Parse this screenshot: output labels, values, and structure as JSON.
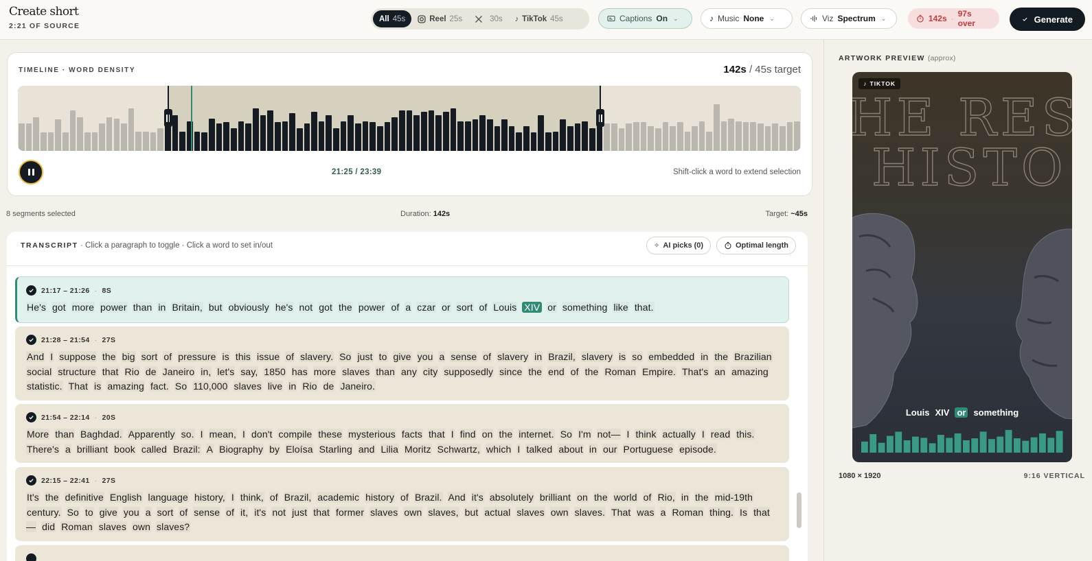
{
  "header": {
    "title": "Create short",
    "subtitle": "2:21 OF SOURCE",
    "platforms": [
      {
        "name": "All",
        "duration": "45s",
        "active": true
      },
      {
        "name": "Reel",
        "duration": "25s",
        "icon": "instagram-icon"
      },
      {
        "name": "",
        "duration": "30s",
        "icon": "x-icon"
      },
      {
        "name": "TikTok",
        "duration": "45s",
        "icon": "tiktok-icon"
      }
    ],
    "captions": {
      "label": "Captions",
      "value": "On"
    },
    "music": {
      "label": "Music",
      "value": "None"
    },
    "viz": {
      "label": "Viz",
      "value": "Spectrum"
    },
    "duration_status": {
      "value": "142s",
      "separator": "·",
      "over": "97s over"
    },
    "generate_label": "Generate"
  },
  "timeline": {
    "label": "TIMELINE · WORD DENSITY",
    "current": "142s",
    "target_text": "/ 45s target",
    "time": "21:25 / 23:39",
    "hint": "Shift-click a word to extend selection",
    "selection_start": 0.192,
    "selection_end": 0.744,
    "playhead": 0.221,
    "densities": [
      0.42,
      0.42,
      0.52,
      0.28,
      0.28,
      0.48,
      0.28,
      0.62,
      0.52,
      0.28,
      0.28,
      0.42,
      0.52,
      0.5,
      0.42,
      0.65,
      0.3,
      0.3,
      0.28,
      0.35,
      0.42,
      0.55,
      0.3,
      0.45,
      0.3,
      0.28,
      0.5,
      0.42,
      0.44,
      0.35,
      0.45,
      0.42,
      0.65,
      0.55,
      0.62,
      0.44,
      0.45,
      0.58,
      0.35,
      0.42,
      0.6,
      0.45,
      0.55,
      0.35,
      0.45,
      0.55,
      0.42,
      0.45,
      0.44,
      0.38,
      0.44,
      0.52,
      0.62,
      0.62,
      0.55,
      0.6,
      0.62,
      0.55,
      0.6,
      0.65,
      0.45,
      0.45,
      0.48,
      0.55,
      0.48,
      0.38,
      0.48,
      0.38,
      0.28,
      0.38,
      0.28,
      0.55,
      0.28,
      0.3,
      0.48,
      0.38,
      0.42,
      0.45,
      0.35,
      0.38,
      0.42,
      0.42,
      0.35,
      0.42,
      0.44,
      0.44,
      0.38,
      0.35,
      0.44,
      0.38,
      0.44,
      0.3,
      0.38,
      0.45,
      0.3,
      0.72,
      0.45,
      0.5,
      0.45,
      0.44,
      0.44,
      0.42,
      0.38,
      0.42,
      0.38,
      0.44,
      0.45
    ]
  },
  "stats": {
    "selected": "8 segments selected",
    "duration_label": "Duration:",
    "duration_value": "142s",
    "target_label": "Target:",
    "target_value": "~45s"
  },
  "transcript": {
    "title": "TRANSCRIPT",
    "subtitle": "· Click a paragraph to toggle · Click a word to set in/out",
    "ai_picks": "AI picks (0)",
    "optimal": "Optimal length",
    "segments": [
      {
        "time": "21:17 – 21:26",
        "duration": "8S",
        "active": true,
        "words": [
          "He's",
          "got",
          "more",
          "power",
          "than",
          "in",
          "Britain,",
          "but",
          "obviously",
          "he's",
          "not",
          "got",
          "the",
          "power",
          "of",
          "a",
          "czar",
          "or",
          "sort",
          "of",
          "Louis",
          "XIV",
          "or",
          "something",
          "like",
          "that."
        ],
        "highlight": 21
      },
      {
        "time": "21:28 – 21:54",
        "duration": "27S",
        "words": [
          "And",
          "I",
          "suppose",
          "the",
          "big",
          "sort",
          "of",
          "pressure",
          "is",
          "this",
          "issue",
          "of",
          "slavery.",
          "So",
          "just",
          "to",
          "give",
          "you",
          "a",
          "sense",
          "of",
          "slavery",
          "in",
          "Brazil,",
          "slavery",
          "is",
          "so",
          "embedded",
          "in",
          "the",
          "Brazilian",
          "social",
          "structure",
          "that",
          "Rio",
          "de",
          "Janeiro",
          "in,",
          "let's",
          "say,",
          "1850",
          "has",
          "more",
          "slaves",
          "than",
          "any",
          "city",
          "supposedly",
          "since",
          "the",
          "end",
          "of",
          "the",
          "Roman",
          "Empire.",
          "That's",
          "an",
          "amazing",
          "statistic.",
          "That",
          "is",
          "amazing",
          "fact.",
          "So",
          "110,000",
          "slaves",
          "live",
          "in",
          "Rio",
          "de",
          "Janeiro."
        ]
      },
      {
        "time": "21:54 – 22:14",
        "duration": "20S",
        "words": [
          "More",
          "than",
          "Baghdad.",
          "Apparently",
          "so.",
          "I",
          "mean,",
          "I",
          "don't",
          "compile",
          "these",
          "mysterious",
          "facts",
          "that",
          "I",
          "find",
          "on",
          "the",
          "internet.",
          "So",
          "I'm",
          "not—",
          "I",
          "think",
          "actually",
          "I",
          "read",
          "this.",
          "There's",
          "a",
          "brilliant",
          "book",
          "called",
          "Brazil:",
          "A",
          "Biography",
          "by",
          "Eloísa",
          "Starling",
          "and",
          "Lilia",
          "Moritz",
          "Schwartz,",
          "which",
          "I",
          "talked",
          "about",
          "in",
          "our",
          "Portuguese",
          "episode."
        ]
      },
      {
        "time": "22:15 – 22:41",
        "duration": "27S",
        "words": [
          "It's",
          "the",
          "definitive",
          "English",
          "language",
          "history,",
          "I",
          "think,",
          "of",
          "Brazil,",
          "academic",
          "history",
          "of",
          "Brazil.",
          "And",
          "it's",
          "absolutely",
          "brilliant",
          "on",
          "the",
          "world",
          "of",
          "Rio,",
          "in",
          "the",
          "mid-19th",
          "century.",
          "So",
          "to",
          "give",
          "you",
          "a",
          "sort",
          "of",
          "sense",
          "of",
          "it,",
          "it's",
          "not",
          "just",
          "that",
          "former",
          "slaves",
          "own",
          "slaves,",
          "but",
          "actual",
          "slaves",
          "own",
          "slaves.",
          "That",
          "was",
          "a",
          "Roman",
          "thing.",
          "Is",
          "that—",
          "did",
          "Roman",
          "slaves",
          "own",
          "slaves?"
        ]
      }
    ]
  },
  "preview": {
    "label": "ARTWORK PREVIEW",
    "approx": "(approx)",
    "badge": "TIKTOK",
    "artwork_text_top": "HE RES",
    "artwork_text_bottom": "HISTO",
    "caption_words": [
      "Louis",
      "XIV",
      "or",
      "something"
    ],
    "caption_highlight": 2,
    "spectrum": [
      0.45,
      0.75,
      0.4,
      0.68,
      0.85,
      0.5,
      0.65,
      0.6,
      0.38,
      0.72,
      0.6,
      0.78,
      0.5,
      0.58,
      0.85,
      0.55,
      0.65,
      0.92,
      0.58,
      0.48,
      0.62,
      0.78,
      0.6,
      0.88
    ],
    "dimensions": "1080 × 1920",
    "ratio": "9:16 VERTICAL"
  }
}
